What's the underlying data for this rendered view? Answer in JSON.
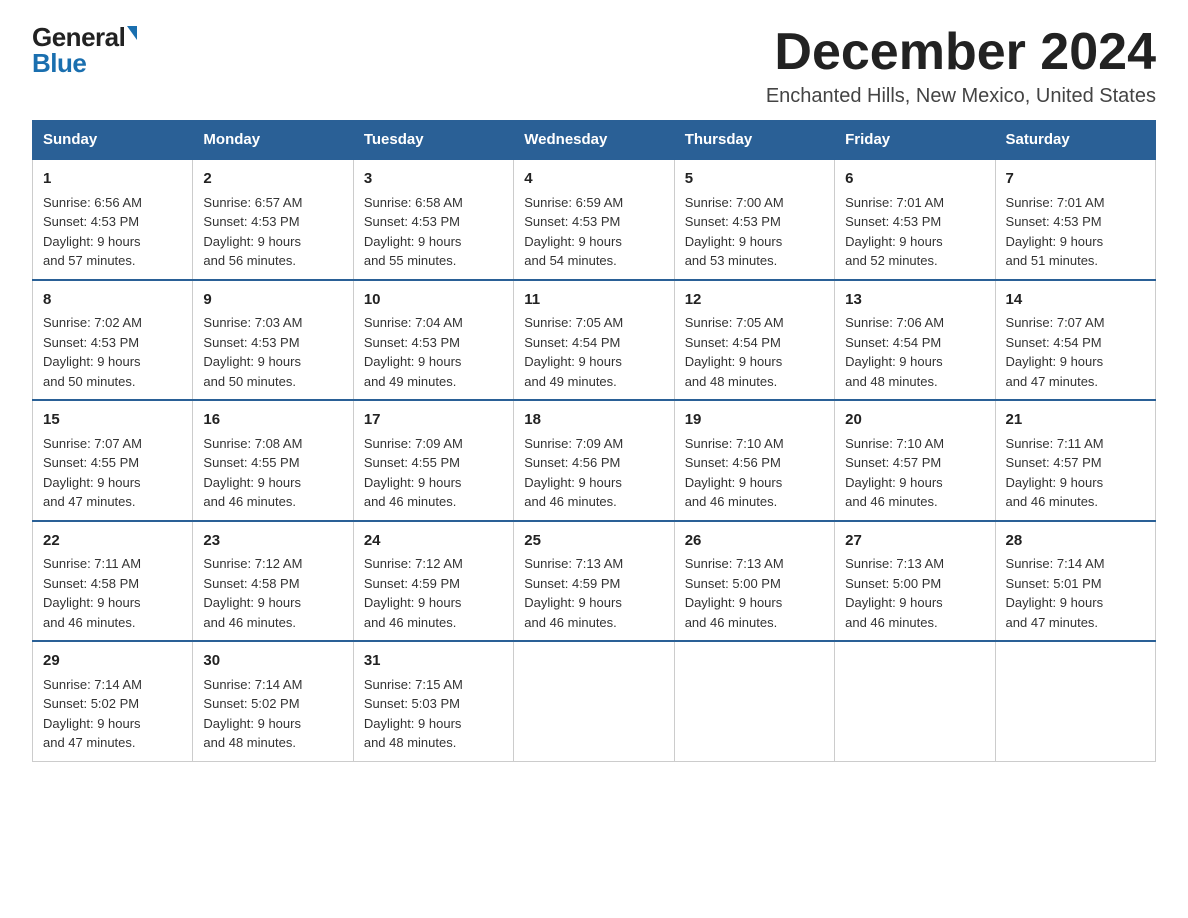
{
  "logo": {
    "general": "General",
    "blue": "Blue"
  },
  "title": "December 2024",
  "subtitle": "Enchanted Hills, New Mexico, United States",
  "days_of_week": [
    "Sunday",
    "Monday",
    "Tuesday",
    "Wednesday",
    "Thursday",
    "Friday",
    "Saturday"
  ],
  "weeks": [
    [
      {
        "day": "1",
        "sunrise": "6:56 AM",
        "sunset": "4:53 PM",
        "daylight": "9 hours and 57 minutes."
      },
      {
        "day": "2",
        "sunrise": "6:57 AM",
        "sunset": "4:53 PM",
        "daylight": "9 hours and 56 minutes."
      },
      {
        "day": "3",
        "sunrise": "6:58 AM",
        "sunset": "4:53 PM",
        "daylight": "9 hours and 55 minutes."
      },
      {
        "day": "4",
        "sunrise": "6:59 AM",
        "sunset": "4:53 PM",
        "daylight": "9 hours and 54 minutes."
      },
      {
        "day": "5",
        "sunrise": "7:00 AM",
        "sunset": "4:53 PM",
        "daylight": "9 hours and 53 minutes."
      },
      {
        "day": "6",
        "sunrise": "7:01 AM",
        "sunset": "4:53 PM",
        "daylight": "9 hours and 52 minutes."
      },
      {
        "day": "7",
        "sunrise": "7:01 AM",
        "sunset": "4:53 PM",
        "daylight": "9 hours and 51 minutes."
      }
    ],
    [
      {
        "day": "8",
        "sunrise": "7:02 AM",
        "sunset": "4:53 PM",
        "daylight": "9 hours and 50 minutes."
      },
      {
        "day": "9",
        "sunrise": "7:03 AM",
        "sunset": "4:53 PM",
        "daylight": "9 hours and 50 minutes."
      },
      {
        "day": "10",
        "sunrise": "7:04 AM",
        "sunset": "4:53 PM",
        "daylight": "9 hours and 49 minutes."
      },
      {
        "day": "11",
        "sunrise": "7:05 AM",
        "sunset": "4:54 PM",
        "daylight": "9 hours and 49 minutes."
      },
      {
        "day": "12",
        "sunrise": "7:05 AM",
        "sunset": "4:54 PM",
        "daylight": "9 hours and 48 minutes."
      },
      {
        "day": "13",
        "sunrise": "7:06 AM",
        "sunset": "4:54 PM",
        "daylight": "9 hours and 48 minutes."
      },
      {
        "day": "14",
        "sunrise": "7:07 AM",
        "sunset": "4:54 PM",
        "daylight": "9 hours and 47 minutes."
      }
    ],
    [
      {
        "day": "15",
        "sunrise": "7:07 AM",
        "sunset": "4:55 PM",
        "daylight": "9 hours and 47 minutes."
      },
      {
        "day": "16",
        "sunrise": "7:08 AM",
        "sunset": "4:55 PM",
        "daylight": "9 hours and 46 minutes."
      },
      {
        "day": "17",
        "sunrise": "7:09 AM",
        "sunset": "4:55 PM",
        "daylight": "9 hours and 46 minutes."
      },
      {
        "day": "18",
        "sunrise": "7:09 AM",
        "sunset": "4:56 PM",
        "daylight": "9 hours and 46 minutes."
      },
      {
        "day": "19",
        "sunrise": "7:10 AM",
        "sunset": "4:56 PM",
        "daylight": "9 hours and 46 minutes."
      },
      {
        "day": "20",
        "sunrise": "7:10 AM",
        "sunset": "4:57 PM",
        "daylight": "9 hours and 46 minutes."
      },
      {
        "day": "21",
        "sunrise": "7:11 AM",
        "sunset": "4:57 PM",
        "daylight": "9 hours and 46 minutes."
      }
    ],
    [
      {
        "day": "22",
        "sunrise": "7:11 AM",
        "sunset": "4:58 PM",
        "daylight": "9 hours and 46 minutes."
      },
      {
        "day": "23",
        "sunrise": "7:12 AM",
        "sunset": "4:58 PM",
        "daylight": "9 hours and 46 minutes."
      },
      {
        "day": "24",
        "sunrise": "7:12 AM",
        "sunset": "4:59 PM",
        "daylight": "9 hours and 46 minutes."
      },
      {
        "day": "25",
        "sunrise": "7:13 AM",
        "sunset": "4:59 PM",
        "daylight": "9 hours and 46 minutes."
      },
      {
        "day": "26",
        "sunrise": "7:13 AM",
        "sunset": "5:00 PM",
        "daylight": "9 hours and 46 minutes."
      },
      {
        "day": "27",
        "sunrise": "7:13 AM",
        "sunset": "5:00 PM",
        "daylight": "9 hours and 46 minutes."
      },
      {
        "day": "28",
        "sunrise": "7:14 AM",
        "sunset": "5:01 PM",
        "daylight": "9 hours and 47 minutes."
      }
    ],
    [
      {
        "day": "29",
        "sunrise": "7:14 AM",
        "sunset": "5:02 PM",
        "daylight": "9 hours and 47 minutes."
      },
      {
        "day": "30",
        "sunrise": "7:14 AM",
        "sunset": "5:02 PM",
        "daylight": "9 hours and 48 minutes."
      },
      {
        "day": "31",
        "sunrise": "7:15 AM",
        "sunset": "5:03 PM",
        "daylight": "9 hours and 48 minutes."
      },
      null,
      null,
      null,
      null
    ]
  ],
  "labels": {
    "sunrise": "Sunrise: ",
    "sunset": "Sunset: ",
    "daylight": "Daylight: "
  },
  "colors": {
    "header_bg": "#2a6096",
    "header_text": "#ffffff",
    "border": "#cccccc",
    "title": "#222222"
  }
}
